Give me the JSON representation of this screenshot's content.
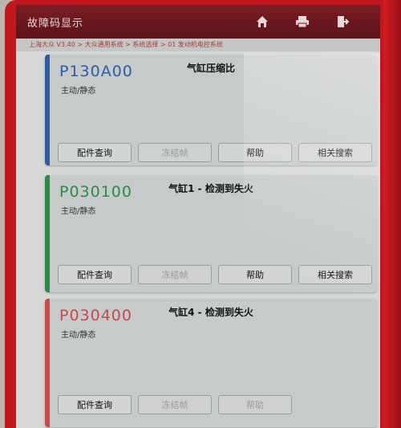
{
  "header": {
    "title": "故障码显示",
    "home_icon": "home-icon",
    "print_icon": "print-icon",
    "exit_icon": "exit-icon"
  },
  "breadcrumb": "上海大众 V3.40 > 大众通用系统 > 系统选择 > 01 发动机电控系统",
  "colors": {
    "card1_accent": "#2c5ba8",
    "card2_accent": "#2b8a4a",
    "card3_accent": "#c94a4a"
  },
  "dtcs": [
    {
      "code": "P130A00",
      "status": "主动/静态",
      "description": "气缸压缩比",
      "buttons": {
        "parts": "配件查询",
        "freeze": "冻结帧",
        "help": "帮助",
        "related": "相关搜索"
      }
    },
    {
      "code": "P030100",
      "status": "主动/静态",
      "description": "气缸1 - 检测到失火",
      "buttons": {
        "parts": "配件查询",
        "freeze": "冻结帧",
        "help": "帮助",
        "related": "相关搜索"
      }
    },
    {
      "code": "P030400",
      "status": "主动/静态",
      "description": "气缸4 - 检测到失火",
      "buttons": {
        "parts": "配件查询",
        "freeze": "冻结帧",
        "help": "帮助"
      }
    }
  ]
}
